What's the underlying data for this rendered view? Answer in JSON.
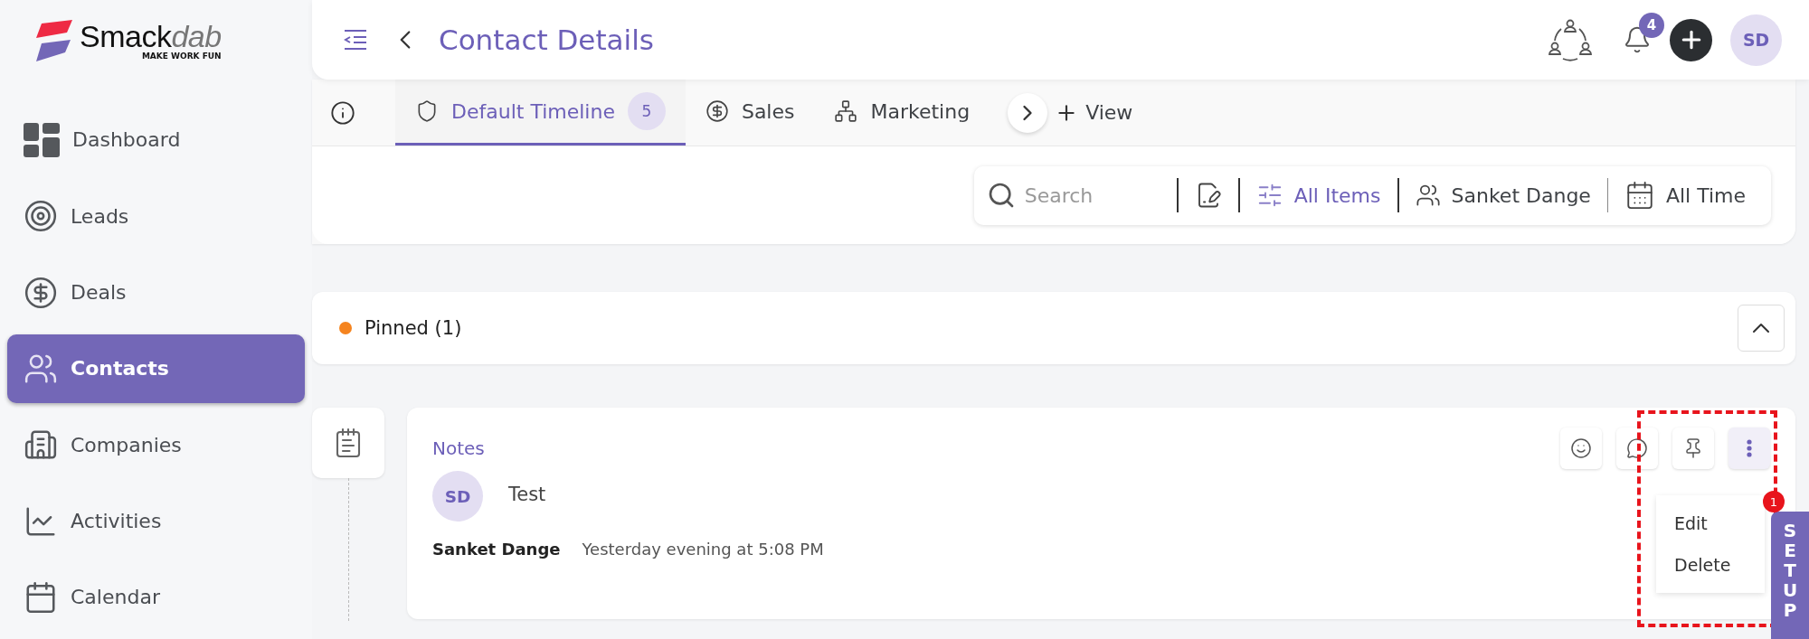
{
  "logo": {
    "name": "Smack",
    "accent": "dab",
    "tagline": "MAKE WORK FUN"
  },
  "sidebar": {
    "items": [
      {
        "label": "Dashboard",
        "selected": false
      },
      {
        "label": "Leads",
        "selected": false
      },
      {
        "label": "Deals",
        "selected": false
      },
      {
        "label": "Contacts",
        "selected": true
      },
      {
        "label": "Companies",
        "selected": false
      },
      {
        "label": "Activities",
        "selected": false
      },
      {
        "label": "Calendar",
        "selected": false
      }
    ]
  },
  "header": {
    "title": "Contact Details",
    "notification_count": "4",
    "avatar": "SD"
  },
  "tabs": [
    {
      "label": "Default Timeline",
      "count": "5",
      "selected": true
    },
    {
      "label": "Sales",
      "selected": false
    },
    {
      "label": "Marketing",
      "selected": false
    }
  ],
  "add_view": "View",
  "toolbar": {
    "search_placeholder": "Search",
    "filter": "All Items",
    "user": "Sanket Dange",
    "range": "All Time"
  },
  "pinned": {
    "label": "Pinned (1)",
    "expanded": true
  },
  "note": {
    "type": "Notes",
    "avatar": "SD",
    "text": "Test",
    "author": "Sanket Dange",
    "time": "Yesterday evening at 5:08 PM"
  },
  "menu": {
    "items": [
      "Edit",
      "Delete"
    ]
  },
  "setup": {
    "label": "SETUP",
    "badge": "1"
  }
}
